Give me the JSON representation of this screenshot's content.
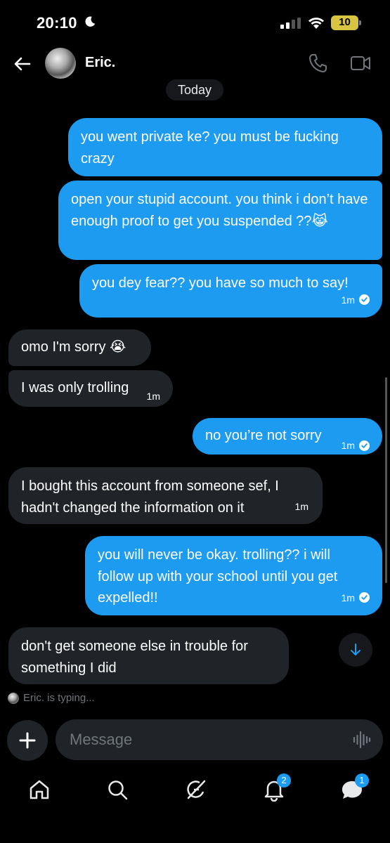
{
  "status_bar": {
    "time": "20:10",
    "battery_level": "10",
    "battery_color": "#d6c442",
    "icons": [
      "moon-icon",
      "signal-icon",
      "wifi-icon",
      "battery-icon"
    ]
  },
  "header": {
    "contact_name": "Eric.",
    "icons": [
      "back-arrow-icon",
      "phone-icon",
      "video-icon"
    ]
  },
  "date_separator": "Today",
  "messages": [
    {
      "direction": "outgoing",
      "text": "you went private ke? you must be fucking crazy"
    },
    {
      "direction": "outgoing",
      "text": "open your stupid account. you think i don’t have enough proof to get you suspended ??😹"
    },
    {
      "direction": "outgoing",
      "text": "you dey fear?? you have so much to say!",
      "time": "1m",
      "read": true
    },
    {
      "direction": "incoming",
      "text": "omo I'm sorry 😭"
    },
    {
      "direction": "incoming",
      "text": "I was only trolling",
      "time": "1m"
    },
    {
      "direction": "outgoing",
      "text": "no you’re not sorry",
      "time": "1m",
      "read": true
    },
    {
      "direction": "incoming",
      "text": "I bought this account from someone sef, I hadn't changed the information on it",
      "time": "1m"
    },
    {
      "direction": "outgoing",
      "text": "you will never be okay. trolling?? i will follow up with your school until you get expelled!!",
      "time": "1m",
      "read": true
    },
    {
      "direction": "incoming",
      "text": "don't get someone else in trouble for something I did"
    }
  ],
  "typing_indicator": "Eric. is typing...",
  "composer": {
    "placeholder": "Message",
    "icons": [
      "plus-icon",
      "voice-wave-icon"
    ]
  },
  "bottom_nav": {
    "items": [
      {
        "name": "home",
        "icon": "home-icon"
      },
      {
        "name": "search",
        "icon": "search-icon"
      },
      {
        "name": "grok",
        "icon": "grok-icon"
      },
      {
        "name": "notifications",
        "icon": "bell-icon",
        "badge": "2"
      },
      {
        "name": "messages",
        "icon": "messages-icon",
        "badge": "1"
      }
    ]
  },
  "colors": {
    "background": "#000000",
    "outgoing_bubble": "#1d9bf0",
    "incoming_bubble": "#202327",
    "muted_text": "#71767b"
  }
}
